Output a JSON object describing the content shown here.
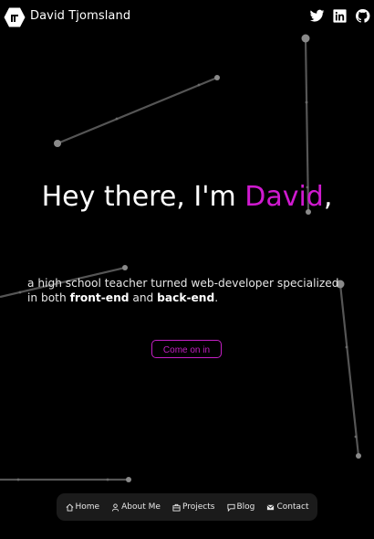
{
  "header": {
    "site_name": "David Tjomsland",
    "logo_icon": "hexagon-logo-icon",
    "social": [
      {
        "icon": "twitter-icon"
      },
      {
        "icon": "linkedin-icon"
      },
      {
        "icon": "github-icon"
      }
    ]
  },
  "hero": {
    "greeting": "Hey there, I'm ",
    "name": "David",
    "punct": ",",
    "tagline_part1": "a high school teacher turned web-developer specialized in both ",
    "tagline_bold1": "front-end",
    "tagline_part2": " and ",
    "tagline_bold2": "back-end",
    "tagline_part3": ".",
    "cta_label": "Come on in"
  },
  "nav": {
    "items": [
      {
        "label": "Home",
        "icon": "home-icon"
      },
      {
        "label": "About Me",
        "icon": "person-icon"
      },
      {
        "label": "Projects",
        "icon": "briefcase-icon"
      },
      {
        "label": "Blog",
        "icon": "chat-icon"
      },
      {
        "label": "Contact",
        "icon": "mail-icon"
      }
    ]
  },
  "colors": {
    "background": "#000000",
    "accent": "#d01ad0",
    "nav_background": "#1b1b1b",
    "lines": "#555555",
    "dots": "#8a8a8a"
  }
}
